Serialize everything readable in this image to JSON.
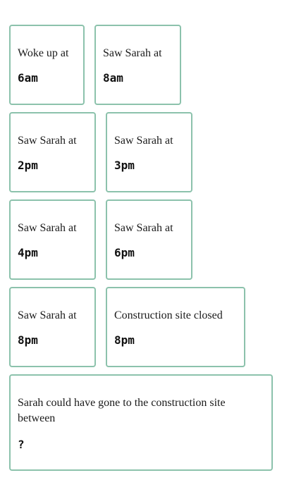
{
  "cards": [
    {
      "label": "Woke up at",
      "value": "6am"
    },
    {
      "label": "Saw Sarah at",
      "value": "8am"
    },
    {
      "label": "Saw Sarah at",
      "value": "2pm"
    },
    {
      "label": "Saw Sarah at",
      "value": "3pm"
    },
    {
      "label": "Saw Sarah at",
      "value": "4pm"
    },
    {
      "label": "Saw Sarah at",
      "value": "6pm"
    },
    {
      "label": "Saw Sarah at",
      "value": "8pm"
    },
    {
      "label": "Construction site closed",
      "value": "8pm"
    }
  ],
  "question": {
    "label": "Sarah could have gone to the construction site between",
    "value": "?"
  }
}
